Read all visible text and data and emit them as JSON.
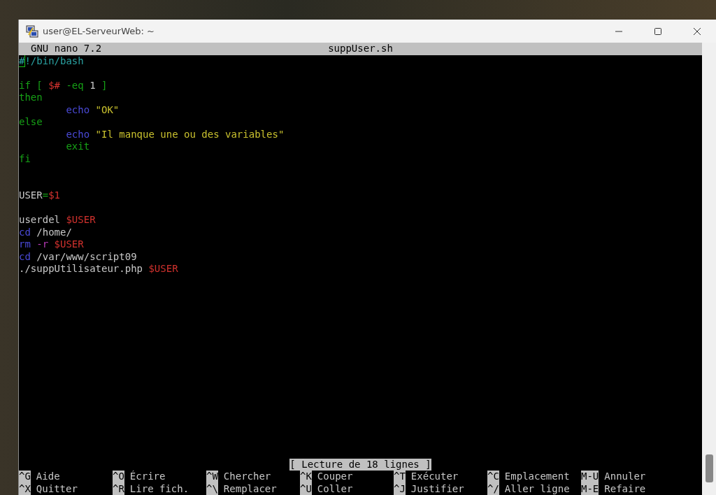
{
  "window": {
    "title": "user@EL-ServeurWeb: ~"
  },
  "editor": {
    "app": "GNU nano 7.2",
    "file": "suppUser.sh",
    "lines": [
      {
        "kind": "code",
        "segments": [
          {
            "text": "#",
            "kind": "shebang",
            "cursor": true
          },
          {
            "text": "!/bin/bash",
            "kind": "shebang",
            "cursor": false
          }
        ]
      },
      {
        "kind": "blank"
      },
      {
        "kind": "code",
        "segments": [
          {
            "text": "if [ ",
            "kind": "keyword"
          },
          {
            "text": "$#",
            "kind": "variable"
          },
          {
            "text": " -eq ",
            "kind": "keyword"
          },
          {
            "text": "1",
            "kind": "plain"
          },
          {
            "text": " ]",
            "kind": "keyword"
          }
        ]
      },
      {
        "segments": [
          {
            "text": "then",
            "kind": "keyword"
          }
        ]
      },
      {
        "segments": [
          {
            "text": "        echo",
            "kind": "builtin"
          },
          {
            "text": " \"OK\"",
            "kind": "string"
          }
        ]
      },
      {
        "segments": [
          {
            "text": "else",
            "kind": "keyword"
          }
        ]
      },
      {
        "segments": [
          {
            "text": "        echo",
            "kind": "builtin"
          },
          {
            "text": " \"Il manque une ou des variables\"",
            "kind": "string"
          }
        ]
      },
      {
        "segments": [
          {
            "text": "        exit",
            "kind": "keyword"
          }
        ]
      },
      {
        "segments": [
          {
            "text": "fi",
            "kind": "keyword"
          }
        ]
      },
      {
        "kind": "blank"
      },
      {
        "kind": "blank"
      },
      {
        "segments": [
          {
            "text": "USER",
            "kind": "plain"
          },
          {
            "text": "=",
            "kind": "keyword"
          },
          {
            "text": "$1",
            "kind": "variable"
          }
        ]
      },
      {
        "kind": "blank"
      },
      {
        "segments": [
          {
            "text": "userdel ",
            "kind": "plain"
          },
          {
            "text": "$USER",
            "kind": "variable"
          }
        ]
      },
      {
        "segments": [
          {
            "text": "cd",
            "kind": "builtin"
          },
          {
            "text": " /home/",
            "kind": "plain"
          }
        ]
      },
      {
        "segments": [
          {
            "text": "rm",
            "kind": "builtin"
          },
          {
            "text": " -r",
            "kind": "option"
          },
          {
            "text": " $USER",
            "kind": "variable"
          }
        ]
      },
      {
        "segments": [
          {
            "text": "cd",
            "kind": "builtin"
          },
          {
            "text": " /var/www/script09",
            "kind": "plain"
          }
        ]
      },
      {
        "segments": [
          {
            "text": "./suppUtilisateur.php ",
            "kind": "plain"
          },
          {
            "text": "$USER",
            "kind": "variable"
          }
        ]
      }
    ],
    "status": "[ Lecture de 18 lignes ]",
    "shortcut_rows": [
      {
        "items": [
          {
            "key": "^G",
            "label": "Aide"
          },
          {
            "key": "^O",
            "label": "Écrire"
          },
          {
            "key": "^W",
            "label": "Chercher"
          },
          {
            "key": "^K",
            "label": "Couper"
          },
          {
            "key": "^T",
            "label": "Exécuter"
          },
          {
            "key": "^C",
            "label": "Emplacement"
          },
          {
            "key": "M-U",
            "label": "Annuler"
          }
        ]
      },
      {
        "items": [
          {
            "key": "^X",
            "label": "Quitter"
          },
          {
            "key": "^R",
            "label": "Lire fich."
          },
          {
            "key": "^\\",
            "label": "Remplacer"
          },
          {
            "key": "^U",
            "label": "Coller"
          },
          {
            "key": "^J",
            "label": "Justifier"
          },
          {
            "key": "^/",
            "label": "Aller ligne"
          },
          {
            "key": "M-E",
            "label": "Refaire"
          }
        ]
      }
    ]
  }
}
